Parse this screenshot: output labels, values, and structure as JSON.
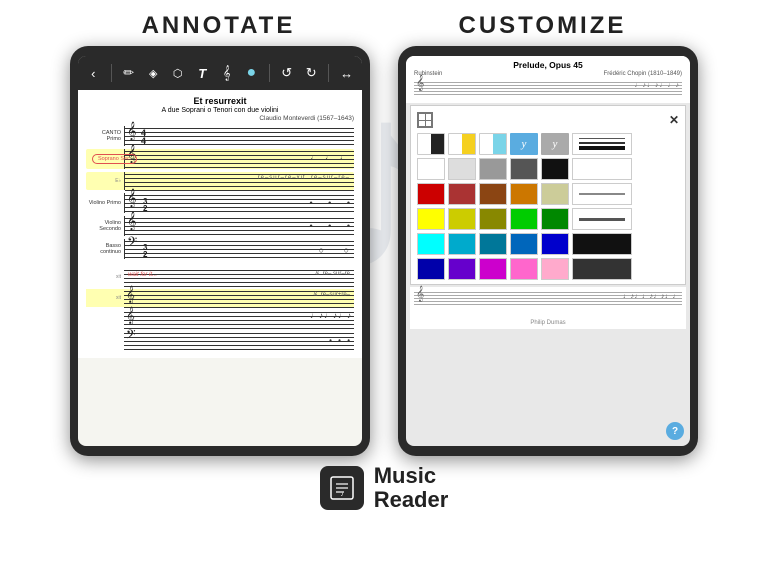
{
  "header": {
    "annotate_label": "ANNOTATE",
    "customize_label": "CUSTOMIZE"
  },
  "left_tablet": {
    "toolbar": {
      "back_btn": "‹",
      "pencil_icon": "✏",
      "highlight_icon": "◈",
      "select_icon": "⬡",
      "text_icon": "T",
      "music_icon": "𝄞",
      "circle_icon": "●",
      "undo_icon": "↺",
      "redo_icon": "↻",
      "arrow_icon": "↔"
    },
    "score": {
      "title": "Et resurrexit",
      "subtitle": "A due Soprani o Tenori con due violini",
      "composer": "Claudio Monteverdi (1567–1643)",
      "staves": [
        {
          "label": "CANTO Primo",
          "highlighted": false
        },
        {
          "label": "Soprano Sec.",
          "highlighted": true,
          "annotation": "Soprano Sec."
        },
        {
          "label": "",
          "highlighted": true
        },
        {
          "label": "Violino Primo",
          "highlighted": false
        },
        {
          "label": "Violino Secondo",
          "highlighted": false
        },
        {
          "label": "Basso continuo",
          "highlighted": false
        }
      ],
      "wait_text": "wait for it...",
      "bottom_highlighted": true
    }
  },
  "right_tablet": {
    "score": {
      "title": "Prelude, Opus 45",
      "composer": "Frédéric Chopin (1810–1849)",
      "instrument": "Rubinstein",
      "performer_label": "Philip Dumas"
    },
    "color_panel": {
      "swatches_row1": [
        {
          "type": "half-white-black",
          "color1": "#ffffff",
          "color2": "#222222"
        },
        {
          "type": "half-white-yellow",
          "color1": "#ffffff",
          "color2": "#f5d020"
        },
        {
          "type": "half-white-cyan",
          "color1": "#ffffff",
          "color2": "#7ad4e8"
        },
        {
          "type": "symbol",
          "label": "y",
          "bg": "#5aace0"
        },
        {
          "type": "symbol",
          "label": "y",
          "bg": "#aaaaaa"
        },
        {
          "type": "lines"
        }
      ],
      "swatches_row2": [
        "#ffffff",
        "#dddddd",
        "#999999",
        "#555555",
        "#111111",
        "#ffffff"
      ],
      "swatches_row3": [
        "#cc0000",
        "#aa2222",
        "#8b4513",
        "#cc7700",
        "#cccc99",
        "#ffffff"
      ],
      "swatches_row4": [
        "#ffff00",
        "#cccc00",
        "#888800",
        "#00cc00",
        "#008800",
        "#ffffff"
      ],
      "swatches_row5": [
        "#00ffff",
        "#00aacc",
        "#006688",
        "#0055aa",
        "#0000cc",
        "#ffffff"
      ],
      "swatches_row6": [
        "#0000aa",
        "#6600cc",
        "#cc00cc",
        "#ff66cc",
        "#ffaacc",
        "#ffffff"
      ],
      "line_styles": [
        "thin",
        "medium",
        "thick"
      ]
    },
    "help_label": "?"
  },
  "footer": {
    "logo_icon": "🎼",
    "app_name_line1": "Music",
    "app_name_line2": "Reader"
  }
}
